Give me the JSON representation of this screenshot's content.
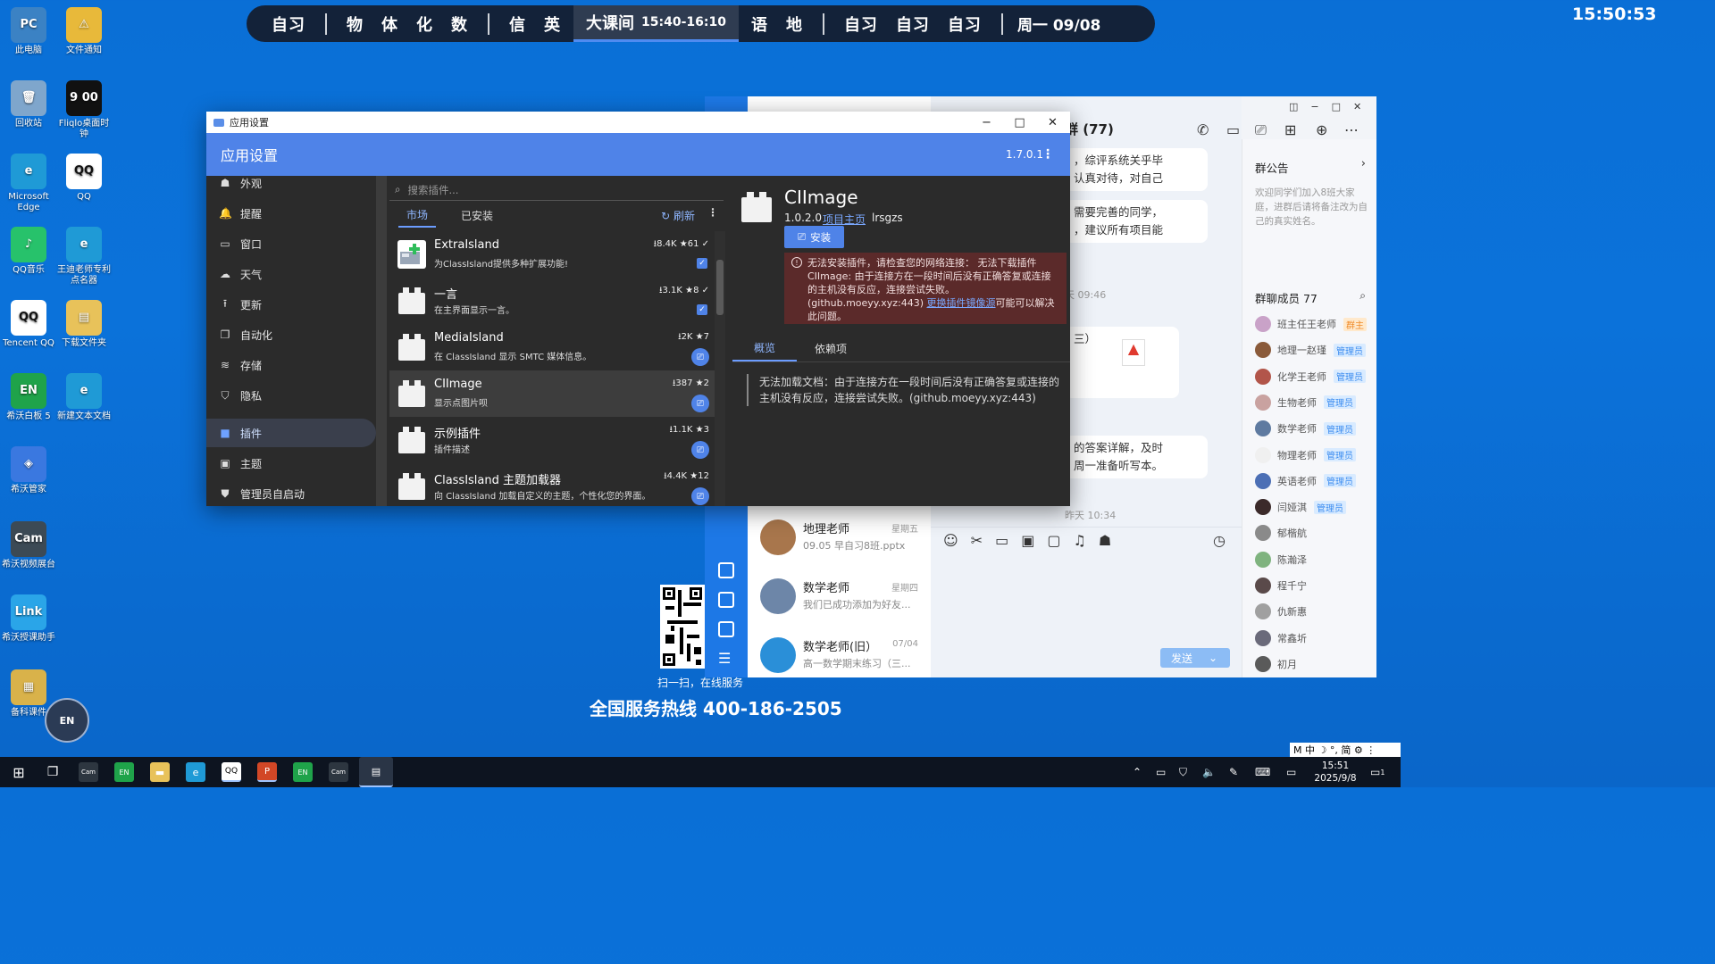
{
  "desktop": {
    "icons": [
      {
        "label": "此电脑",
        "glyph": "PC",
        "color": "#3b82c4"
      },
      {
        "label": "文件通知",
        "glyph": "⚠",
        "color": "#e8b93a"
      },
      {
        "label": "回收站",
        "glyph": "🗑",
        "color": "#7fa6cc"
      },
      {
        "label": "Fliqlo桌面时钟",
        "glyph": "9 00",
        "color": "#111111"
      },
      {
        "label": "Microsoft Edge",
        "glyph": "e",
        "color": "#1f9ad6"
      },
      {
        "label": "QQ",
        "glyph": "QQ",
        "color": "#ffffff"
      },
      {
        "label": "QQ音乐",
        "glyph": "♪",
        "color": "#27c26b"
      },
      {
        "label": "王迪老师专利点名器",
        "glyph": "e",
        "color": "#1f9ad6"
      },
      {
        "label": "Tencent QQ",
        "glyph": "QQ",
        "color": "#ffffff"
      },
      {
        "label": "下载文件夹",
        "glyph": "▤",
        "color": "#e8c25a"
      },
      {
        "label": "希沃白板 5",
        "glyph": "EN",
        "color": "#1fa34a"
      },
      {
        "label": "新建文本文档",
        "glyph": "e",
        "color": "#1f9ad6"
      },
      {
        "label": "希沃管家",
        "glyph": "◈",
        "color": "#3a78e0"
      },
      {
        "label": "希沃视频展台",
        "glyph": "Cam",
        "color": "#3c4a55"
      },
      {
        "label": "希沃授课助手",
        "glyph": "Link",
        "color": "#2aa5e8"
      },
      {
        "label": "备科课件",
        "glyph": "▦",
        "color": "#d9b24a"
      }
    ]
  },
  "schedule": {
    "group1": [
      "自习"
    ],
    "group2": [
      "物",
      "体",
      "化",
      "数"
    ],
    "group3": [
      "信",
      "英"
    ],
    "current_label": "大课间",
    "current_time": "15:40-16:10",
    "group4": [
      "语",
      "地"
    ],
    "group5": [
      "自习",
      "自习",
      "自习"
    ],
    "date": "周一 09/08",
    "clock": "15:50:53"
  },
  "settings": {
    "window_title": "应用设置",
    "app_title": "应用设置",
    "version": "1.7.0.1",
    "nav": [
      {
        "label": "外观",
        "icon": "appearance-icon",
        "glyph": "☗"
      },
      {
        "label": "提醒",
        "icon": "bell-icon",
        "glyph": "🔔"
      },
      {
        "label": "窗口",
        "icon": "window-icon",
        "glyph": "▭"
      },
      {
        "label": "天气",
        "icon": "cloud-icon",
        "glyph": "☁"
      },
      {
        "label": "更新",
        "icon": "update-icon",
        "glyph": "⭱"
      },
      {
        "label": "自动化",
        "icon": "automation-icon",
        "glyph": "❐"
      },
      {
        "label": "存储",
        "icon": "storage-icon",
        "glyph": "≋"
      },
      {
        "label": "隐私",
        "icon": "privacy-icon",
        "glyph": "⛉"
      },
      {
        "label": "插件",
        "icon": "plugin-icon",
        "glyph": "■",
        "active": true
      },
      {
        "label": "主题",
        "icon": "theme-icon",
        "glyph": "▣"
      },
      {
        "label": "管理员自启动",
        "icon": "admin-icon",
        "glyph": "⛊"
      }
    ],
    "search_placeholder": "搜索插件...",
    "tabs": [
      "市场",
      "已安装"
    ],
    "refresh_label": "刷新",
    "plugins": [
      {
        "name": "ExtraIsland",
        "desc": "为ClassIsland提供多种扩展功能!",
        "stats": "⭳8.4K ★61 ✓",
        "action": "check"
      },
      {
        "name": "一言",
        "desc": "在主界面显示一言。",
        "stats": "⭳3.1K ★8 ✓",
        "action": "check"
      },
      {
        "name": "MediaIsland",
        "desc": "在 ClassIsland 显示 SMTC 媒体信息。",
        "stats": "⭳2K ★7",
        "action": "install"
      },
      {
        "name": "CIImage",
        "desc": "显示点图片呗",
        "stats": "⭳387 ★2",
        "action": "install",
        "selected": true
      },
      {
        "name": "示例插件",
        "desc": "插件描述",
        "stats": "⭳1.1K ★3",
        "action": "install"
      },
      {
        "name": "ClassIsland 主题加载器",
        "desc": "向 ClassIsland 加载自定义的主题，个性化您的界面。",
        "stats": "⭳4.4K ★12",
        "action": "install"
      }
    ],
    "detail": {
      "name": "CIImage",
      "version": "1.0.2.0",
      "homepage_label": "项目主页",
      "author": "lrsgzs",
      "install_label": "安装",
      "error_text": "无法安装插件，请检查您的网络连接： 无法下载插件 CIImage: 由于连接方在一段时间后没有正确答复或连接的主机没有反应，连接尝试失败。(github.moeyy.xyz:443)",
      "error_link": "更换插件镜像源",
      "error_suffix": "可能可以解决此问题。",
      "tabs": [
        "概览",
        "依赖项"
      ],
      "doc_error": "无法加载文档：由于连接方在一段时间后没有正确答复或连接的主机没有反应，连接尝试失败。(github.moeyy.xyz:443)"
    }
  },
  "qq": {
    "group_title": "群 (77)",
    "bubbles": [
      "，综评系统关乎毕",
      "认真对待，对自己",
      "需要完善的同学，",
      "，建议所有项目能",
      "三）",
      "的答案详解，及时",
      "周一准备听写本。"
    ],
    "stamps": [
      "天 09:46",
      "昨天 10:34"
    ],
    "conversations": [
      {
        "name": "地理老师",
        "time": "星期五",
        "preview": "09.05 早自习8班.pptx"
      },
      {
        "name": "数学老师",
        "time": "星期四",
        "preview": "我们已成功添加为好友..."
      },
      {
        "name": "数学老师(旧）",
        "time": "07/04",
        "preview": "高一数学期末练习（三..."
      }
    ],
    "notice_title": "群公告",
    "notice_text": "欢迎同学们加入8班大家庭，进群后请将备注改为自己的真实姓名。",
    "members_title": "群聊成员 77",
    "members": [
      {
        "name": "班主任王老师",
        "role": "群主"
      },
      {
        "name": "地理一赵瑾",
        "role": "管理员"
      },
      {
        "name": "化学王老师",
        "role": "管理员"
      },
      {
        "name": "生物老师",
        "role": "管理员"
      },
      {
        "name": "数学老师",
        "role": "管理员"
      },
      {
        "name": "物理老师",
        "role": "管理员"
      },
      {
        "name": "英语老师",
        "role": "管理员"
      },
      {
        "name": "闫娅淇",
        "role": "管理员"
      },
      {
        "name": "郁楷航",
        "role": ""
      },
      {
        "name": "陈瀚泽",
        "role": ""
      },
      {
        "name": "程千宁",
        "role": ""
      },
      {
        "name": "仇新惠",
        "role": ""
      },
      {
        "name": "常鑫圻",
        "role": ""
      },
      {
        "name": "初月",
        "role": ""
      }
    ],
    "send_label": "发送"
  },
  "ad": {
    "scan_text": "扫一扫，在线服务",
    "hotline": "全国服务热线 400-186-2505"
  },
  "taskbar": {
    "time": "15:51",
    "date": "2025/9/8",
    "ime": "M 中 ☽ °, 简 ⚙ ⋮",
    "notification_count": "1"
  },
  "en_bubble": "EN"
}
